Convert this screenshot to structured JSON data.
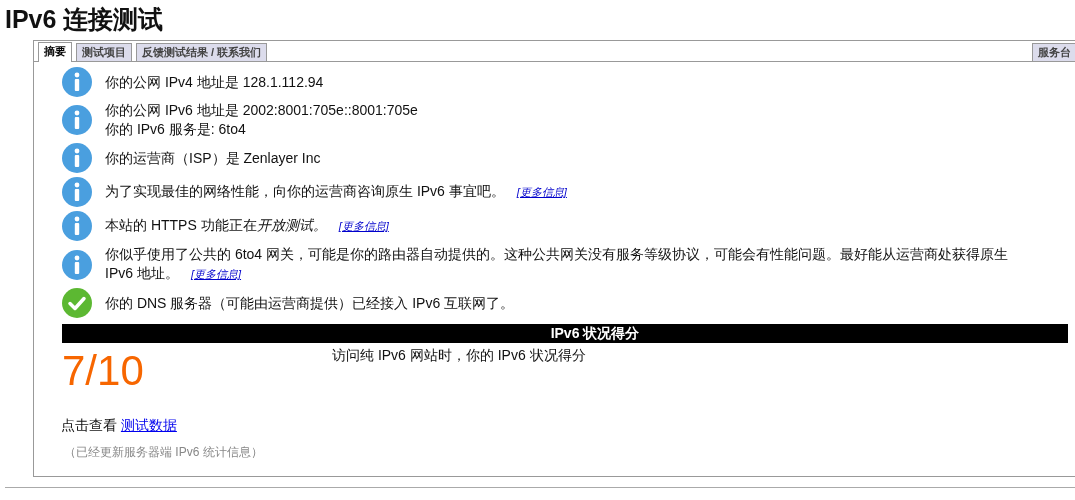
{
  "title": "IPv6 连接测试",
  "tabs": [
    {
      "label": "摘要",
      "selected": true
    },
    {
      "label": "测试项目",
      "selected": false
    },
    {
      "label": "反馈测试结果 / 联系我们",
      "selected": false
    }
  ],
  "side_tab": {
    "label": "服务台",
    "selected": false
  },
  "messages": [
    {
      "kind": "info",
      "lines": [
        "你的公网 IPv4 地址是 128.1.112.94"
      ]
    },
    {
      "kind": "info",
      "lines": [
        "你的公网 IPv6 地址是 2002:8001:705e::8001:705e",
        "你的 IPv6 服务是: 6to4"
      ]
    },
    {
      "kind": "info",
      "lines": [
        "你的运营商（ISP）是 Zenlayer Inc"
      ]
    },
    {
      "kind": "info",
      "lines": [
        "为了实现最佳的网络性能，向你的运营商咨询原生 IPv6 事宜吧。"
      ],
      "link": "[更多信息]"
    },
    {
      "kind": "info",
      "lines": [
        "本站的 HTTPS 功能正在"
      ],
      "emphasis": "开放测试。",
      "link": "[更多信息]"
    },
    {
      "kind": "info",
      "lines": [
        "你似乎使用了公共的 6to4 网关，可能是你的路由器自动提供的。这种公共网关没有服务等级协议，可能会有性能问题。最好能从运营商处获得原生",
        "IPv6 地址。"
      ],
      "link": "[更多信息]"
    },
    {
      "kind": "ok",
      "lines": [
        "你的 DNS 服务器（可能由运营商提供）已经接入 IPv6 互联网了。"
      ]
    }
  ],
  "score": {
    "heading": "IPv6 状况得分",
    "value": "7/10",
    "caption": "访问纯 IPv6 网站时，你的 IPv6 状况得分"
  },
  "details": {
    "label": "点击查看",
    "link": "测试数据"
  },
  "note": "（已经更新服务器端 IPv6 统计信息）"
}
